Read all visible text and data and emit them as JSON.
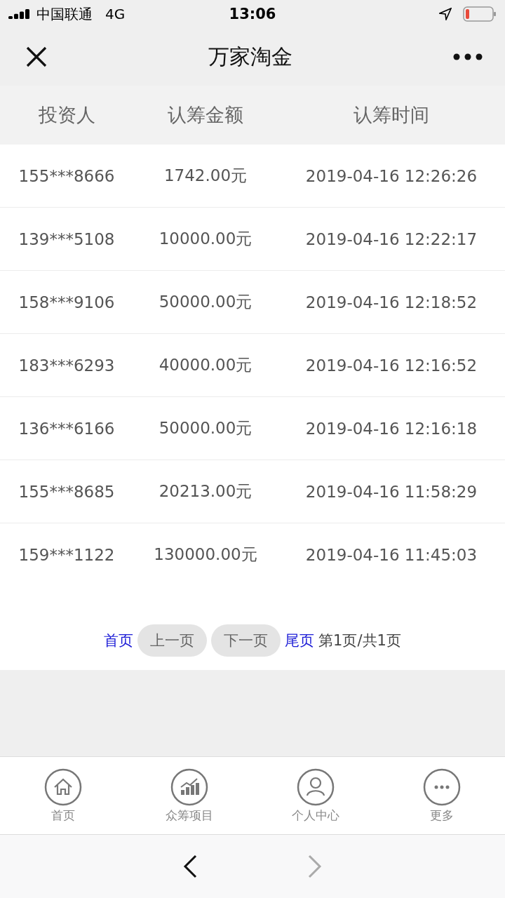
{
  "status_bar": {
    "carrier": "中国联通",
    "network": "4G",
    "time": "13:06"
  },
  "nav": {
    "title": "万家淘金"
  },
  "table": {
    "columns": [
      "投资人",
      "认筹金额",
      "认筹时间"
    ],
    "rows": [
      [
        "155***8666",
        "1742.00元",
        "2019-04-16 12:26:26"
      ],
      [
        "139***5108",
        "10000.00元",
        "2019-04-16 12:22:17"
      ],
      [
        "158***9106",
        "50000.00元",
        "2019-04-16 12:18:52"
      ],
      [
        "183***6293",
        "40000.00元",
        "2019-04-16 12:16:52"
      ],
      [
        "136***6166",
        "50000.00元",
        "2019-04-16 12:16:18"
      ],
      [
        "155***8685",
        "20213.00元",
        "2019-04-16 11:58:29"
      ],
      [
        "159***1122",
        "130000.00元",
        "2019-04-16 11:45:03"
      ]
    ]
  },
  "pagination": {
    "first": "首页",
    "prev": "上一页",
    "next": "下一页",
    "last": "尾页",
    "info": "第1页/共1页"
  },
  "tab_bar": [
    {
      "kind": "home",
      "label": "首页"
    },
    {
      "kind": "chart",
      "label": "众筹项目"
    },
    {
      "kind": "person",
      "label": "个人中心"
    },
    {
      "kind": "more",
      "label": "更多"
    }
  ],
  "browser_bar": {
    "back_disabled": false,
    "forward_disabled": true
  }
}
